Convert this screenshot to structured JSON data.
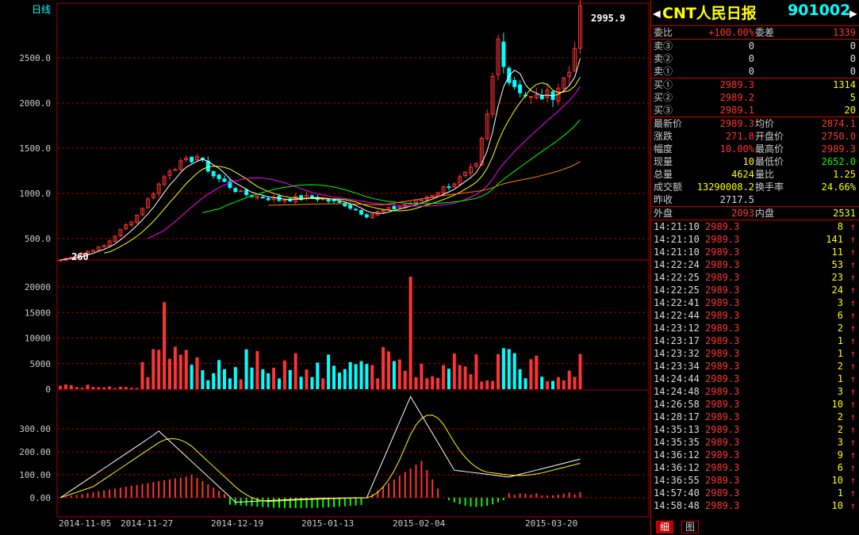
{
  "chart": {
    "period_label": "日线",
    "price_axis": [
      "2500.0",
      "2000.0",
      "1500.0",
      "1000.0",
      "500.0"
    ],
    "price_axis_values": [
      2500,
      2000,
      1500,
      1000,
      500
    ],
    "volume_axis": [
      "20000",
      "15000",
      "10000",
      "5000",
      "0"
    ],
    "volume_axis_values": [
      20000,
      15000,
      10000,
      5000,
      0
    ],
    "macd_axis": [
      "300.00",
      "200.00",
      "100.00",
      "0.00"
    ],
    "macd_axis_values": [
      300,
      200,
      100,
      0
    ],
    "high_label": "2995.9",
    "low_label": "260",
    "dates": [
      "2014-11-05",
      "2014-11-27",
      "2014-12-19",
      "2015-01-13",
      "2015-02-04",
      "2015-03-20"
    ],
    "colors": {
      "up": "#ff3333",
      "down": "#00ffff",
      "grid": "#aa0000",
      "ma5": "#ffffff",
      "ma10": "#ffff00",
      "ma20": "#ff00ff",
      "ma30": "#00ff00",
      "ma60": "#ff8000"
    }
  },
  "panel": {
    "name": "CNT人民日报",
    "code": "901002",
    "left_arrow": "◀",
    "right_arrow": "▶",
    "weibi": {
      "label": "委比",
      "value": "+100.00%",
      "label2": "委差",
      "value2": "1339"
    },
    "sells": [
      {
        "label": "卖③",
        "price": "0",
        "vol": "0"
      },
      {
        "label": "卖②",
        "price": "0",
        "vol": "0"
      },
      {
        "label": "卖①",
        "price": "0",
        "vol": "0"
      }
    ],
    "buys": [
      {
        "label": "买①",
        "price": "2989.3",
        "vol": "1314"
      },
      {
        "label": "买②",
        "price": "2989.2",
        "vol": "5"
      },
      {
        "label": "买③",
        "price": "2989.1",
        "vol": "20"
      }
    ],
    "stats": [
      {
        "l1": "最新价",
        "v1": "2989.3",
        "c1": "red",
        "l2": "均价",
        "v2": "2874.1",
        "c2": "red"
      },
      {
        "l1": "涨跌",
        "v1": "271.8",
        "c1": "red",
        "l2": "开盘价",
        "v2": "2750.0",
        "c2": "red"
      },
      {
        "l1": "幅度",
        "v1": "10.00%",
        "c1": "red",
        "l2": "最高价",
        "v2": "2989.3",
        "c2": "red"
      },
      {
        "l1": "现量",
        "v1": "10",
        "c1": "yel",
        "l2": "最低价",
        "v2": "2652.0",
        "c2": "grn"
      },
      {
        "l1": "总量",
        "v1": "4624",
        "c1": "yel",
        "l2": "量比",
        "v2": "1.25",
        "c2": "yel"
      },
      {
        "l1": "成交额",
        "v1": "13290008.2",
        "c1": "yel",
        "l2": "换手率",
        "v2": "24.66%",
        "c2": "yel"
      },
      {
        "l1": "昨收",
        "v1": "2717.5",
        "c1": "wht",
        "l2": "",
        "v2": "",
        "c2": "wht"
      }
    ],
    "outer": {
      "l1": "外盘",
      "v1": "2093",
      "l2": "内盘",
      "v2": "2531"
    },
    "trades": [
      {
        "time": "14:21:10",
        "price": "2989.3",
        "vol": "8",
        "arrow": "↑"
      },
      {
        "time": "14:21:10",
        "price": "2989.3",
        "vol": "141",
        "arrow": "↑"
      },
      {
        "time": "14:21:10",
        "price": "2989.3",
        "vol": "11",
        "arrow": "↑"
      },
      {
        "time": "14:22:24",
        "price": "2989.3",
        "vol": "53",
        "arrow": "↑"
      },
      {
        "time": "14:22:25",
        "price": "2989.3",
        "vol": "23",
        "arrow": "↑"
      },
      {
        "time": "14:22:25",
        "price": "2989.3",
        "vol": "24",
        "arrow": "↑"
      },
      {
        "time": "14:22:41",
        "price": "2989.3",
        "vol": "3",
        "arrow": "↑"
      },
      {
        "time": "14:22:44",
        "price": "2989.3",
        "vol": "6",
        "arrow": "↑"
      },
      {
        "time": "14:23:12",
        "price": "2989.3",
        "vol": "2",
        "arrow": "↑"
      },
      {
        "time": "14:23:17",
        "price": "2989.3",
        "vol": "1",
        "arrow": "↑"
      },
      {
        "time": "14:23:32",
        "price": "2989.3",
        "vol": "1",
        "arrow": "↑"
      },
      {
        "time": "14:23:34",
        "price": "2989.3",
        "vol": "2",
        "arrow": "↑"
      },
      {
        "time": "14:24:44",
        "price": "2989.3",
        "vol": "1",
        "arrow": "↑"
      },
      {
        "time": "14:24:48",
        "price": "2989.3",
        "vol": "3",
        "arrow": "↑"
      },
      {
        "time": "14:26:58",
        "price": "2989.3",
        "vol": "10",
        "arrow": "↑"
      },
      {
        "time": "14:28:17",
        "price": "2989.3",
        "vol": "2",
        "arrow": "↑"
      },
      {
        "time": "14:35:13",
        "price": "2989.3",
        "vol": "2",
        "arrow": "↑"
      },
      {
        "time": "14:35:35",
        "price": "2989.3",
        "vol": "3",
        "arrow": "↑"
      },
      {
        "time": "14:36:12",
        "price": "2989.3",
        "vol": "9",
        "arrow": "↑"
      },
      {
        "time": "14:36:12",
        "price": "2989.3",
        "vol": "6",
        "arrow": "↑"
      },
      {
        "time": "14:36:55",
        "price": "2989.3",
        "vol": "10",
        "arrow": "↑"
      },
      {
        "time": "14:57:40",
        "price": "2989.3",
        "vol": "1",
        "arrow": "↑"
      },
      {
        "time": "14:58:48",
        "price": "2989.3",
        "vol": "10",
        "arrow": "↑"
      }
    ],
    "tabs": [
      "细",
      "图"
    ]
  }
}
